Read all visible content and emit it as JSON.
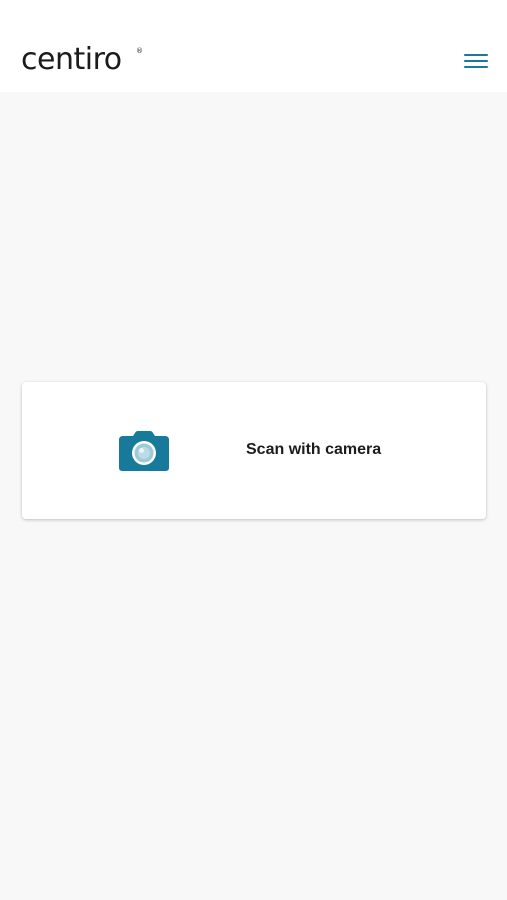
{
  "header": {
    "logo_text": "centiro",
    "logo_mark": "®",
    "menu_icon": "hamburger-menu-icon"
  },
  "scan_card": {
    "icon": "camera-icon",
    "label": "Scan with camera"
  },
  "colors": {
    "accent": "#177a9b",
    "background": "#f8f8f8",
    "header_background": "#ffffff",
    "card_background": "#ffffff",
    "text": "#1c1c1c"
  }
}
